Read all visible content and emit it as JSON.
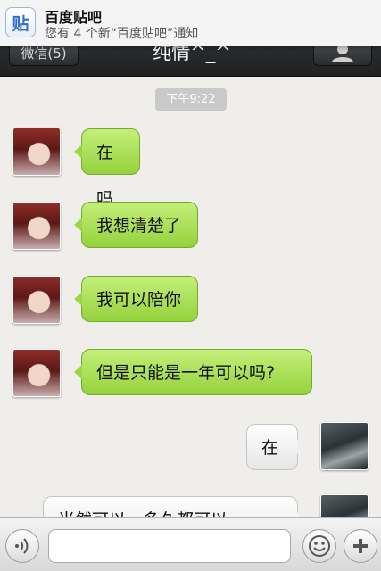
{
  "notification": {
    "app_icon_glyph": "贴",
    "title": "百度贴吧",
    "message": "您有 4 个新“百度贴吧”通知"
  },
  "header": {
    "back_label": "微信(5)",
    "title": "纯情^_^"
  },
  "chat": {
    "timestamp": "下午9:22",
    "messages": [
      {
        "from": "contact",
        "text": "在吗"
      },
      {
        "from": "contact",
        "text": "我想清楚了"
      },
      {
        "from": "contact",
        "text": "我可以陪你"
      },
      {
        "from": "contact",
        "text": "但是只能是一年可以吗?"
      },
      {
        "from": "me",
        "text": "在"
      },
      {
        "from": "me",
        "text": "当然可以，多久都可以"
      }
    ]
  },
  "input_bar": {
    "placeholder": "",
    "voice_icon": "voice-icon",
    "emoji_icon": "smiley-icon",
    "add_icon": "plus-icon"
  },
  "colors": {
    "incoming_bubble": "#a8dd52",
    "outgoing_bubble": "#f2f2f2",
    "header_bg": "#2b2d30",
    "accent_blue": "#2f6fc9"
  }
}
